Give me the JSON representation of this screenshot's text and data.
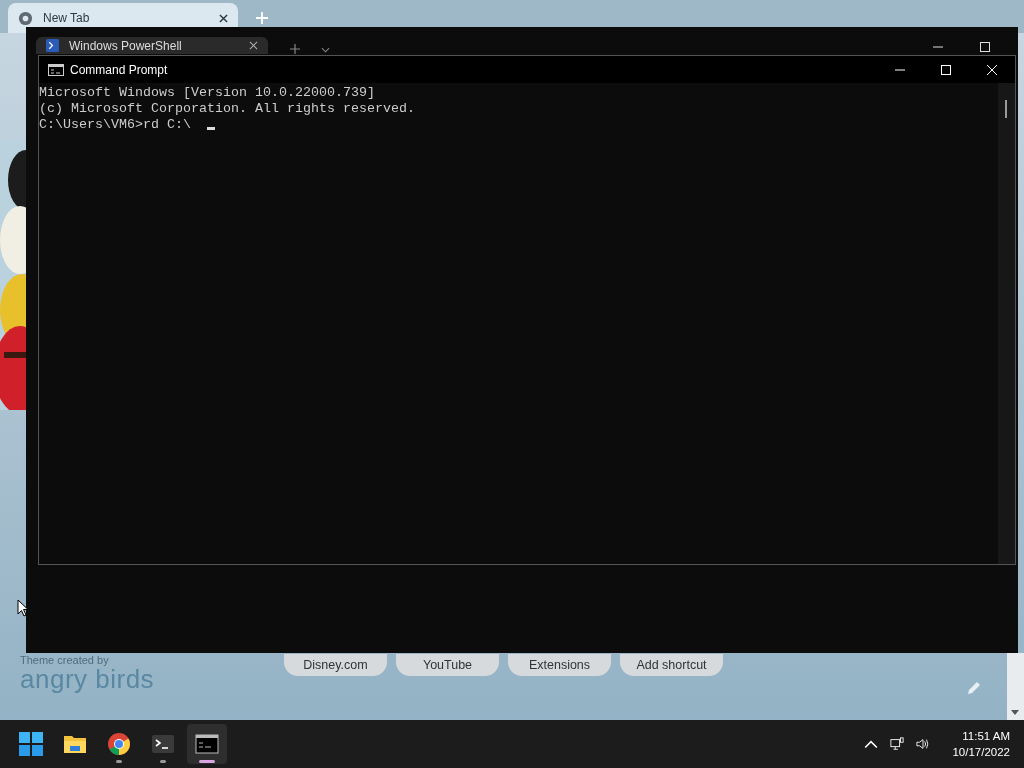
{
  "chrome": {
    "tab": {
      "title": "New Tab"
    },
    "shortcuts": [
      "Disney.com",
      "YouTube",
      "Extensions",
      "Add shortcut"
    ],
    "theme": {
      "caption": "Theme created by",
      "name": "angry birds"
    }
  },
  "powershell": {
    "tab": {
      "title": "Windows PowerShell"
    }
  },
  "cmd": {
    "title": "Command Prompt",
    "lines": [
      "Microsoft Windows [Version 10.0.22000.739]",
      "(c) Microsoft Corporation. All rights reserved.",
      "C:\\Users\\VM6>rd C:\\"
    ]
  },
  "taskbar": {
    "apps": [
      {
        "kind": "start",
        "running": false,
        "selected": false
      },
      {
        "kind": "explorer",
        "running": false,
        "selected": false
      },
      {
        "kind": "chrome",
        "running": true,
        "selected": false
      },
      {
        "kind": "terminal",
        "running": true,
        "selected": false
      },
      {
        "kind": "cmd",
        "running": true,
        "selected": true
      }
    ],
    "time": "11:51 AM",
    "date": "10/17/2022"
  }
}
